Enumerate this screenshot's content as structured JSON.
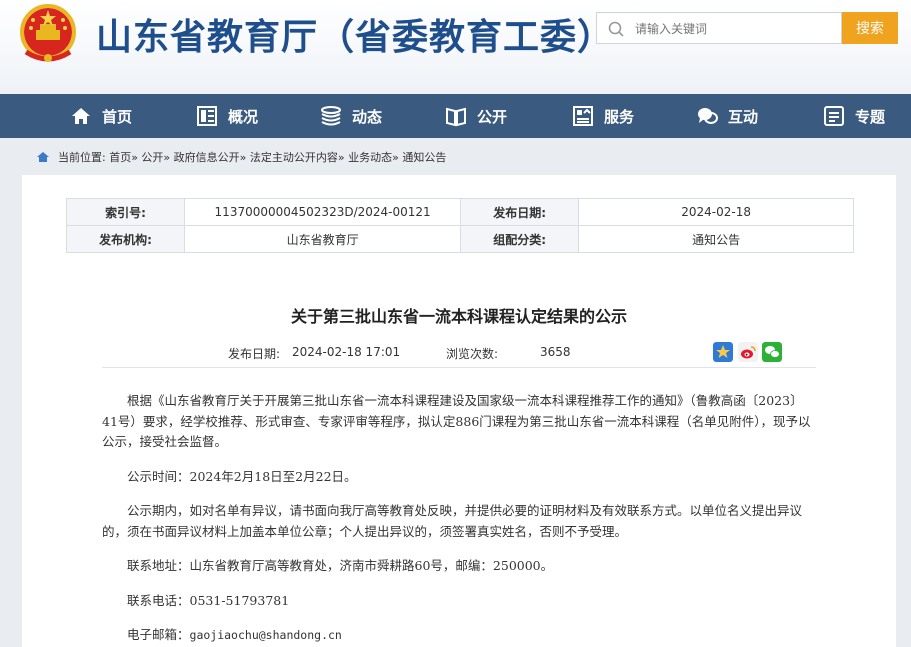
{
  "header": {
    "site_title": "山东省教育厅（省委教育工委）",
    "search_placeholder": "请输入关键词",
    "search_button": "搜索"
  },
  "nav": {
    "items": [
      {
        "label": "首页",
        "icon": "home-icon"
      },
      {
        "label": "概况",
        "icon": "overview-icon"
      },
      {
        "label": "动态",
        "icon": "news-icon"
      },
      {
        "label": "公开",
        "icon": "book-icon"
      },
      {
        "label": "服务",
        "icon": "service-icon"
      },
      {
        "label": "互动",
        "icon": "chat-icon"
      },
      {
        "label": "专题",
        "icon": "topic-icon"
      }
    ]
  },
  "breadcrumb": {
    "text": "当前位置: 首页» 公开» 政府信息公开» 法定主动公开内容» 业务动态» 通知公告"
  },
  "meta": {
    "index_label": "索引号:",
    "index_value": "11370000004502323D/2024-00121",
    "date_label": "发布日期:",
    "date_value": "2024-02-18",
    "org_label": "发布机构:",
    "org_value": "山东省教育厅",
    "group_label": "组配分类:",
    "group_value": "通知公告"
  },
  "article": {
    "title": "关于第三批山东省一流本科课程认定结果的公示",
    "publish_label": "发布日期:",
    "publish_value": "2024-02-18 17:01",
    "views_label": "浏览次数:",
    "views_value": "3658",
    "para1": "根据《山东省教育厅关于开展第三批山东省一流本科课程建设及国家级一流本科课程推荐工作的通知》（鲁教高函〔2023〕41号）要求，经学校推荐、形式审查、专家评审等程序，拟认定886门课程为第三批山东省一流本科课程（名单见附件），现予以公示，接受社会监督。",
    "para2": "公示时间：2024年2月18日至2月22日。",
    "para3": "公示期内，如对名单有异议，请书面向我厅高等教育处反映，并提供必要的证明材料及有效联系方式。以单位名义提出异议的，须在书面异议材料上加盖本单位公章；个人提出异议的，须签署真实姓名，否则不予受理。",
    "para4": "联系地址：山东省教育厅高等教育处，济南市舜耕路60号，邮编：250000。",
    "phone_label": "联系电话：",
    "phone_value": "0531-51793781",
    "email_label": "电子邮箱：",
    "email_value": "gaojiaochu@shandong.cn"
  },
  "colors": {
    "brand_blue": "#1f4e8c",
    "nav_bg": "#3a5a80",
    "search_orange": "#f0a31e"
  }
}
